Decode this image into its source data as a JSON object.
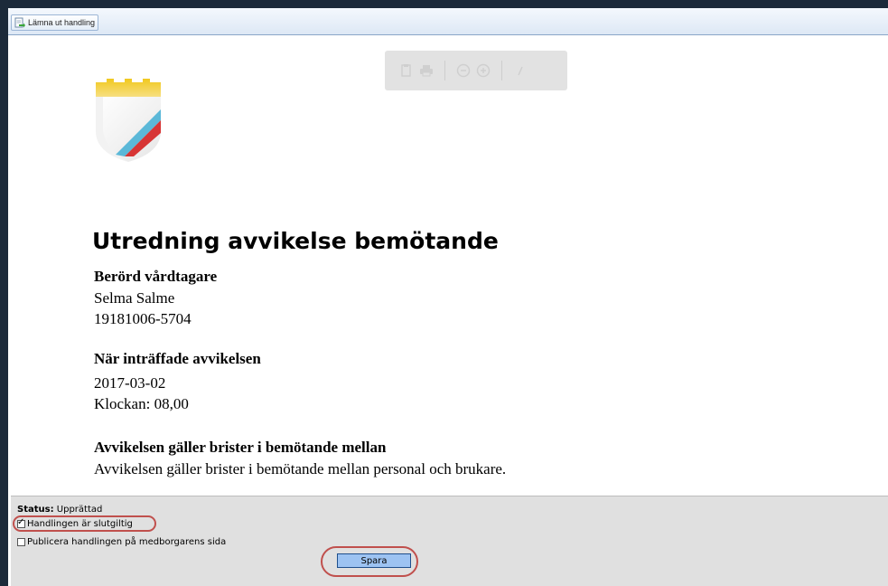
{
  "toolbar": {
    "submit_label": "Lämna ut handling",
    "submit_icon": "document-arrow-icon"
  },
  "viewer_toolbar": {
    "icons": [
      "copy-icon",
      "print-icon",
      "zoom-out-icon",
      "zoom-in-icon",
      "edit-icon"
    ]
  },
  "document": {
    "title": "Utredning avvikelse bemötande",
    "affected": {
      "heading": "Berörd vårdtagare",
      "name": "Selma Salme",
      "id": "19181006-5704"
    },
    "occurred": {
      "heading": "När inträffade avvikelsen",
      "date": "2017-03-02",
      "time": "Klockan: 08,00"
    },
    "concerns": {
      "heading": "Avvikelsen gäller brister i bemötande mellan",
      "text": "Avvikelsen gäller brister i bemötande mellan personal och brukare."
    }
  },
  "bottom_panel": {
    "status_label": "Status:",
    "status_value": "Upprättad",
    "final_checkbox": {
      "label": "Handlingen är slutgiltig",
      "checked": true
    },
    "publish_checkbox": {
      "label": "Publicera handlingen på medborgarens sida",
      "checked": false
    },
    "save_label": "Spara"
  },
  "colors": {
    "annotation": "#c0504d",
    "save_button": "#9dc3f2",
    "frame": "#1c2a3a"
  }
}
